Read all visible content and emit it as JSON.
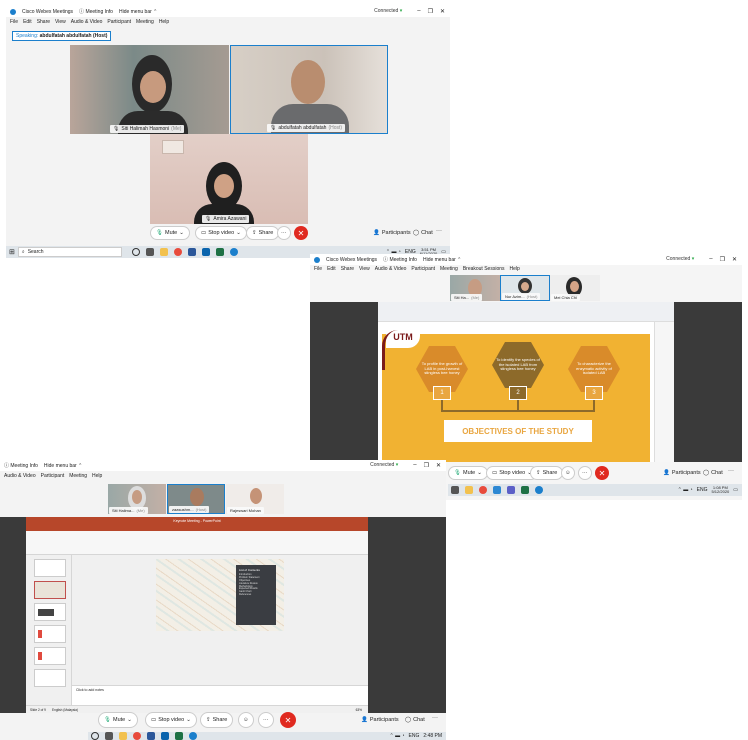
{
  "win1": {
    "title": "Cisco Webex Meetings",
    "meeting_info": "Meeting Info",
    "hide_menu_bar": "Hide menu bar",
    "connected": "Connected",
    "menu": [
      "File",
      "Edit",
      "Share",
      "View",
      "Audio & Video",
      "Participant",
      "Meeting",
      "Help"
    ],
    "speaking_label": "Speaking:",
    "speaking_name": "abdulfatah abdulfatah (Host)",
    "participants": [
      {
        "name": "Siti Halimah Hasmoni",
        "role": "(Me)"
      },
      {
        "name": "abdulfatah abdulfatah",
        "role": "(Host)"
      },
      {
        "name": "Amira Azawani",
        "role": ""
      }
    ],
    "controls": {
      "mute": "Mute",
      "stop_video": "Stop video",
      "share": "Share",
      "participants": "Participants",
      "chat": "Chat",
      "more": "···",
      "end": "✕"
    },
    "taskbar": {
      "search": "Search",
      "lang": "ENG",
      "time": "3:51 PM",
      "date": "6/11/2020"
    }
  },
  "win2": {
    "title": "Cisco Webex Meetings",
    "meeting_info": "Meeting Info",
    "hide_menu_bar": "Hide menu bar",
    "connected": "Connected",
    "menu": [
      "File",
      "Edit",
      "Share",
      "View",
      "Audio & Video",
      "Participant",
      "Meeting",
      "Breakout Sessions",
      "Help"
    ],
    "thumbs": [
      {
        "name": "Siti Ha...",
        "role": "(Me)"
      },
      {
        "name": "Nur Azim...",
        "role": "(Host)"
      },
      {
        "name": "Mei Chia Chi",
        "role": ""
      }
    ],
    "slide": {
      "logo": "UTM",
      "objectives": [
        "To profile the growth of LAB in post-harvest stingless bee honey",
        "To identify the species of the isolated LAB from stingless bee honey",
        "To characterize the enzymatic activity of isolated LAB"
      ],
      "numbers": [
        "1",
        "2",
        "3"
      ],
      "heading": "OBJECTIVES OF THE STUDY"
    },
    "controls": {
      "mute": "Mute",
      "stop_video": "Stop video",
      "share": "Share",
      "participants": "Participants",
      "chat": "Chat",
      "more": "···",
      "end": "✕"
    },
    "taskbar": {
      "lang": "ENG",
      "time": "1:08 PM",
      "date": "5/12/2020"
    }
  },
  "win3": {
    "meeting_info": "Meeting Info",
    "hide_menu_bar": "Hide menu bar",
    "connected": "Connected",
    "menu": [
      "Audio & Video",
      "Participant",
      "Meeting",
      "Help"
    ],
    "thumbs": [
      {
        "name": "Siti Halima...",
        "role": "(Me)"
      },
      {
        "name": "zaasushm...",
        "role": "(Host)"
      },
      {
        "name": "Rajeswari Mohan",
        "role": ""
      }
    ],
    "ppt": {
      "title": "Keynote Meeting - PowerPoint",
      "click_notes": "Click to add notes",
      "slide_status": "Slide 2 of 9",
      "lang": "English (Malaysia)",
      "content_title": "List of Contents",
      "contents": [
        "Introduction",
        "Problem Statement",
        "Objectives",
        "Literature Review",
        "Methodology",
        "Expected Results",
        "Gantt Chart",
        "References"
      ],
      "zoom": "63%"
    },
    "controls": {
      "mute": "Mute",
      "stop_video": "Stop video",
      "share": "Share",
      "participants": "Participants",
      "chat": "Chat",
      "more": "···",
      "end": "✕"
    },
    "taskbar": {
      "lang": "ENG",
      "time": "2:48 PM"
    }
  },
  "colors": {
    "webex_blue": "#1b7fcc",
    "end_red": "#e02a20",
    "slide_orange": "#f1b232",
    "slide_brown": "#8d6a2a",
    "ppt_red": "#b7472a"
  }
}
